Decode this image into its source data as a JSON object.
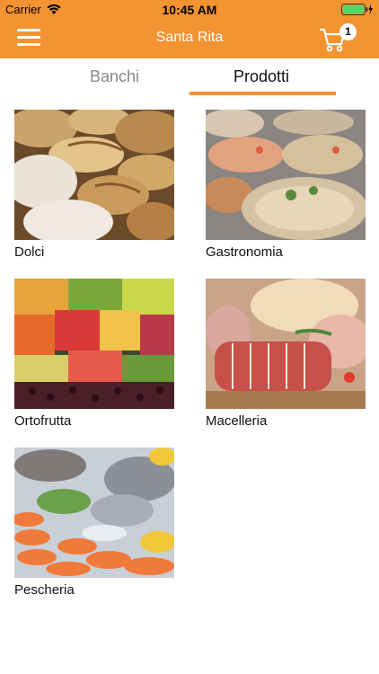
{
  "status_bar": {
    "carrier": "Carrier",
    "time": "10:45 AM"
  },
  "nav": {
    "title": "Santa Rita",
    "cart_count": "1"
  },
  "tabs": [
    {
      "label": "Banchi"
    },
    {
      "label": "Prodotti"
    }
  ],
  "categories": [
    {
      "label": "Dolci"
    },
    {
      "label": "Gastronomia"
    },
    {
      "label": "Ortofrutta"
    },
    {
      "label": "Macelleria"
    },
    {
      "label": "Pescheria"
    }
  ],
  "colors": {
    "accent": "#f39332",
    "battery": "#4cd964"
  }
}
